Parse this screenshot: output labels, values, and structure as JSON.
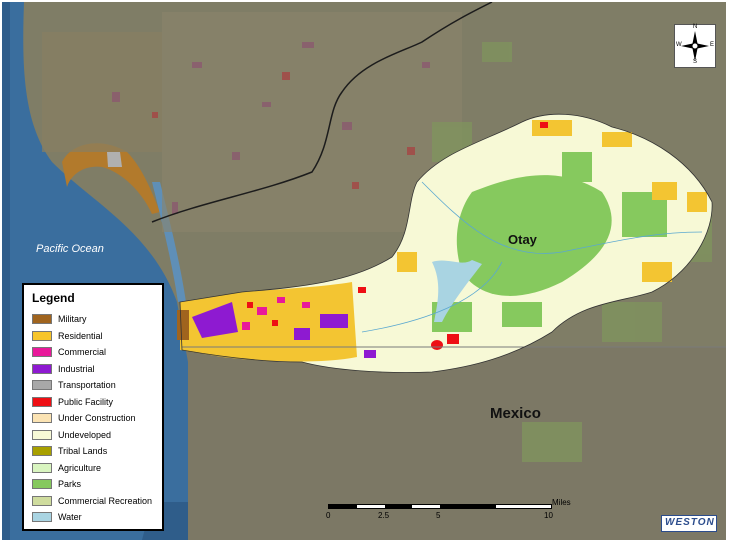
{
  "map": {
    "labels": {
      "ocean": "Pacific Ocean",
      "watershed": "Otay",
      "country": "Mexico"
    },
    "north_arrow": {
      "n": "N",
      "s": "S",
      "e": "E",
      "w": "W"
    },
    "legend": {
      "title": "Legend",
      "items": [
        {
          "label": "Military",
          "color": "#a0641e"
        },
        {
          "label": "Residential",
          "color": "#f7c52a"
        },
        {
          "label": "Commercial",
          "color": "#e8199a"
        },
        {
          "label": "Industrial",
          "color": "#8e1ad1"
        },
        {
          "label": "Transportation",
          "color": "#a8a8a8"
        },
        {
          "label": "Public Facility",
          "color": "#ee0f14"
        },
        {
          "label": "Under Construction",
          "color": "#fbe3b3"
        },
        {
          "label": "Undeveloped",
          "color": "#f7f9d6"
        },
        {
          "label": "Tribal Lands",
          "color": "#a8a000"
        },
        {
          "label": "Agriculture",
          "color": "#d9f5c0"
        },
        {
          "label": "Parks",
          "color": "#86c95e"
        },
        {
          "label": "Commercial Recreation",
          "color": "#cfdc9e"
        },
        {
          "label": "Water",
          "color": "#a9d4e2"
        }
      ]
    },
    "scale": {
      "unit": "Miles",
      "ticks": [
        "0",
        "2.5",
        "5",
        "10"
      ]
    },
    "logo": "WESTON"
  }
}
